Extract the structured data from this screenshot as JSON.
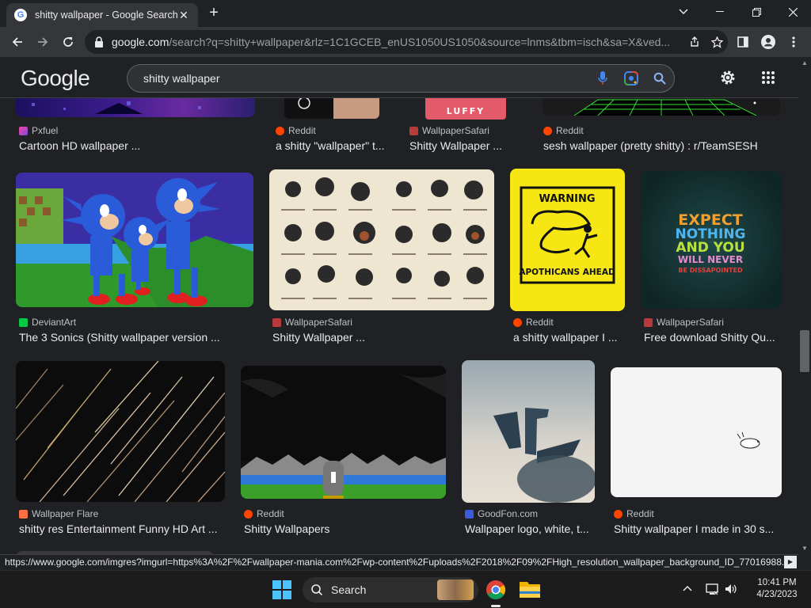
{
  "browser": {
    "tab_title": "shitty wallpaper - Google Search",
    "url_domain": "google.com",
    "url_path": "/search?q=shitty+wallpaper&rlz=1C1GCEB_enUS1050US1050&source=lnms&tbm=isch&sa=X&ved..."
  },
  "search": {
    "query": "shitty wallpaper",
    "logo_text": "Google"
  },
  "rows": {
    "row0": [
      {
        "source": "Pxfuel",
        "caption": "Cartoon HD wallpaper ...",
        "icon_color": "#c04bd4"
      },
      {
        "source": "Reddit",
        "caption": "a shitty \"wallpaper\" t...",
        "icon_color": "#ff4500"
      },
      {
        "source": "WallpaperSafari",
        "caption": "Shitty Wallpaper ...",
        "icon_color": "#d9534f"
      },
      {
        "source": "Reddit",
        "caption": "sesh wallpaper (pretty shitty) : r/TeamSESH",
        "icon_color": "#ff4500"
      }
    ],
    "row1": [
      {
        "source": "DeviantArt",
        "caption": "The 3 Sonics (Shitty wallpaper version ...",
        "icon_color": "#05cc47"
      },
      {
        "source": "WallpaperSafari",
        "caption": "Shitty Wallpaper ...",
        "icon_color": "#d9534f"
      },
      {
        "source": "Reddit",
        "caption": "a shitty wallpaper I ...",
        "icon_color": "#ff4500"
      },
      {
        "source": "WallpaperSafari",
        "caption": "Free download Shitty Qu...",
        "icon_color": "#d9534f"
      }
    ],
    "row2": [
      {
        "source": "Wallpaper Flare",
        "caption": "shitty res Entertainment Funny HD Art ...",
        "icon_color": "#ff7043"
      },
      {
        "source": "Reddit",
        "caption": "Shitty Wallpapers",
        "icon_color": "#ff4500"
      },
      {
        "source": "GoodFon.com",
        "caption": "Wallpaper logo, white, t...",
        "icon_color": "#3b5bdb"
      },
      {
        "source": "Reddit",
        "caption": "Shitty wallpaper I made in 30 s...",
        "icon_color": "#ff4500"
      }
    ]
  },
  "image_text": {
    "luffy": "LUFFY",
    "warning": "WARNING",
    "apothicans": "APOTHICANS AHEAD",
    "expect1": "EXPECT",
    "expect2": "NOTHING",
    "expect3": "AND YOU",
    "expect4": "WILL NEVER",
    "expect5": "BE DISSAPOINTED"
  },
  "status_url": "https://www.google.com/imgres?imgurl=https%3A%2F%2Fwallpaper-mania.com%2Fwp-content%2Fuploads%2F2018%2F09%2FHigh_resolution_wallpaper_background_ID_77016988...",
  "taskbar": {
    "search_label": "Search",
    "time": "10:41 PM",
    "date": "4/23/2023"
  }
}
